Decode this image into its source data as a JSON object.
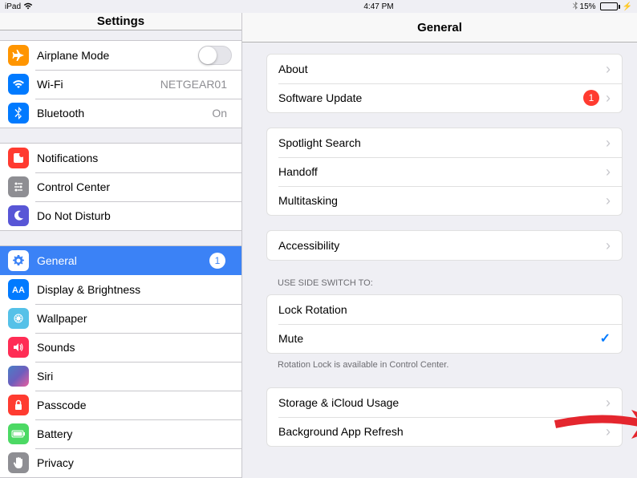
{
  "status": {
    "device": "iPad",
    "time": "4:47 PM",
    "battery_pct": "15%"
  },
  "sidebar": {
    "title": "Settings",
    "groups": [
      [
        {
          "id": "airplane",
          "label": "Airplane Mode",
          "icon": "airplane-icon",
          "type": "toggle"
        },
        {
          "id": "wifi",
          "label": "Wi-Fi",
          "icon": "wifi-icon",
          "value": "NETGEAR01",
          "type": "nav"
        },
        {
          "id": "bluetooth",
          "label": "Bluetooth",
          "icon": "bluetooth-icon",
          "value": "On",
          "type": "nav"
        }
      ],
      [
        {
          "id": "notifications",
          "label": "Notifications",
          "icon": "notifications-icon",
          "type": "nav"
        },
        {
          "id": "controlcenter",
          "label": "Control Center",
          "icon": "control-center-icon",
          "type": "nav"
        },
        {
          "id": "dnd",
          "label": "Do Not Disturb",
          "icon": "moon-icon",
          "type": "nav"
        }
      ],
      [
        {
          "id": "general",
          "label": "General",
          "icon": "gear-icon",
          "type": "nav",
          "selected": true,
          "badge": "1"
        },
        {
          "id": "display",
          "label": "Display & Brightness",
          "icon": "display-icon",
          "type": "nav"
        },
        {
          "id": "wallpaper",
          "label": "Wallpaper",
          "icon": "wallpaper-icon",
          "type": "nav"
        },
        {
          "id": "sounds",
          "label": "Sounds",
          "icon": "speaker-icon",
          "type": "nav"
        },
        {
          "id": "siri",
          "label": "Siri",
          "icon": "siri-icon",
          "type": "nav"
        },
        {
          "id": "passcode",
          "label": "Passcode",
          "icon": "lock-icon",
          "type": "nav"
        },
        {
          "id": "battery",
          "label": "Battery",
          "icon": "battery-icon",
          "type": "nav"
        },
        {
          "id": "privacy",
          "label": "Privacy",
          "icon": "hand-icon",
          "type": "nav"
        }
      ]
    ]
  },
  "detail": {
    "title": "General",
    "groups": [
      {
        "items": [
          {
            "id": "about",
            "label": "About",
            "type": "chevron"
          },
          {
            "id": "software-update",
            "label": "Software Update",
            "type": "chevron",
            "badge": "1"
          }
        ]
      },
      {
        "items": [
          {
            "id": "spotlight",
            "label": "Spotlight Search",
            "type": "chevron"
          },
          {
            "id": "handoff",
            "label": "Handoff",
            "type": "chevron"
          },
          {
            "id": "multitasking",
            "label": "Multitasking",
            "type": "chevron"
          }
        ]
      },
      {
        "items": [
          {
            "id": "accessibility",
            "label": "Accessibility",
            "type": "chevron"
          }
        ]
      },
      {
        "header": "USE SIDE SWITCH TO:",
        "footer": "Rotation Lock is available in Control Center.",
        "items": [
          {
            "id": "lock-rotation",
            "label": "Lock Rotation",
            "type": "check",
            "checked": false
          },
          {
            "id": "mute",
            "label": "Mute",
            "type": "check",
            "checked": true
          }
        ]
      },
      {
        "items": [
          {
            "id": "storage",
            "label": "Storage & iCloud Usage",
            "type": "chevron"
          },
          {
            "id": "background-refresh",
            "label": "Background App Refresh",
            "type": "chevron"
          }
        ]
      }
    ]
  }
}
